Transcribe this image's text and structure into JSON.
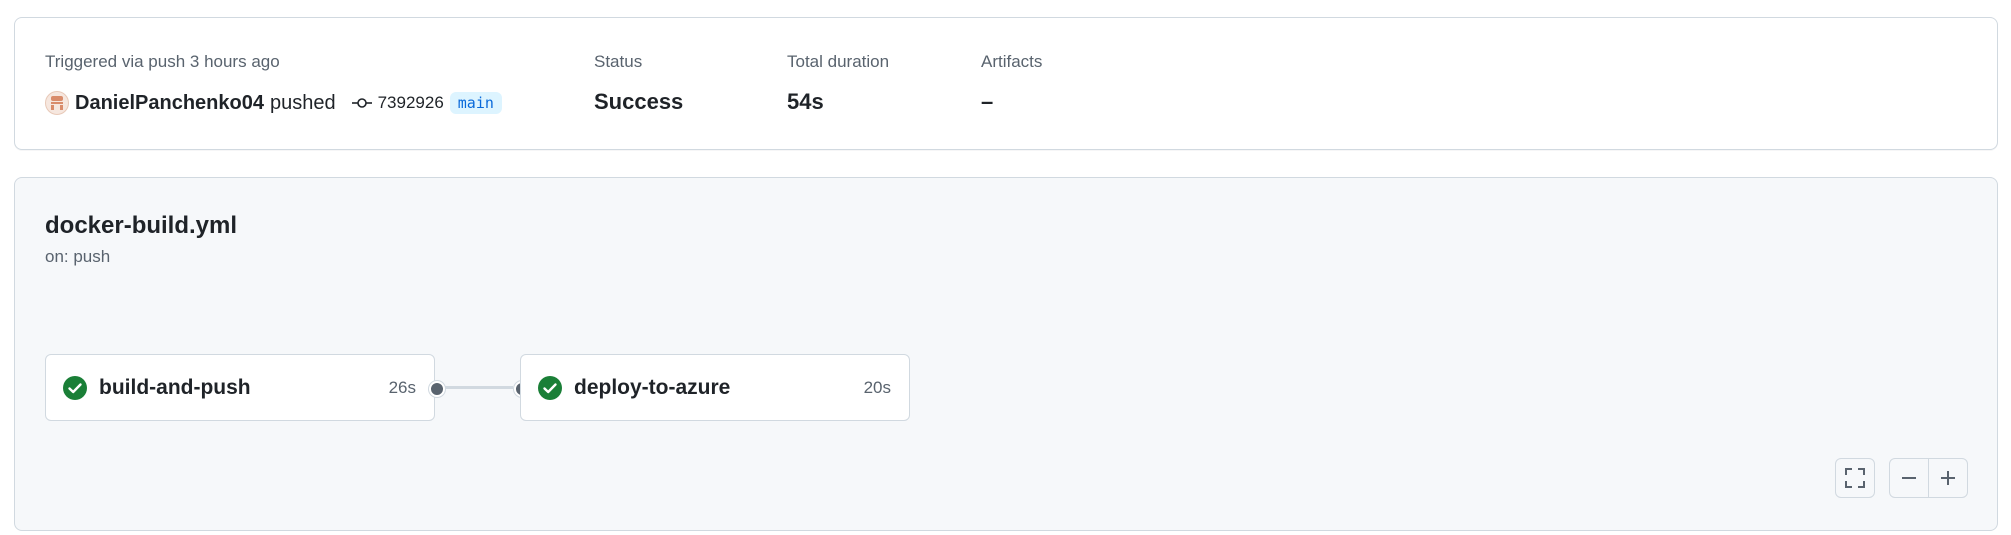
{
  "summary": {
    "trigger_text": "Triggered via push 3 hours ago",
    "actor": "DanielPanchenko04",
    "action": "pushed",
    "commit_sha": "7392926",
    "branch": "main",
    "status_label": "Status",
    "status_value": "Success",
    "duration_label": "Total duration",
    "duration_value": "54s",
    "artifacts_label": "Artifacts",
    "artifacts_value": "–"
  },
  "workflow": {
    "file_name": "docker-build.yml",
    "trigger": "on: push",
    "jobs": [
      {
        "name": "build-and-push",
        "duration": "26s",
        "status": "success"
      },
      {
        "name": "deploy-to-azure",
        "duration": "20s",
        "status": "success"
      }
    ]
  },
  "controls": {
    "fullscreen_icon": "fullscreen-icon",
    "zoom_out_icon": "minus-icon",
    "zoom_in_icon": "plus-icon"
  },
  "colors": {
    "success": "#1a7f37",
    "branch_bg": "#ddf4ff",
    "branch_text": "#0969da",
    "muted_text": "#59636e",
    "canvas_bg": "#f6f8fa",
    "border": "#d1d9e0"
  }
}
